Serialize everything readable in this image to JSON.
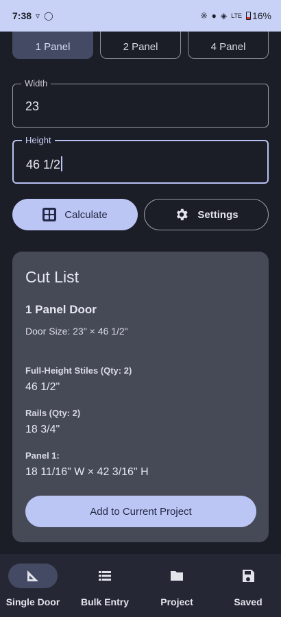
{
  "status_bar": {
    "time": "7:38",
    "signal_label": "LTE",
    "battery": "16%"
  },
  "panel_options": {
    "items": [
      "1 Panel",
      "2 Panel",
      "4 Panel"
    ],
    "selected": "1 Panel"
  },
  "inputs": {
    "width": {
      "label": "Width",
      "value": "23"
    },
    "height": {
      "label": "Height",
      "value": "46 1/2"
    }
  },
  "actions": {
    "calculate_label": "Calculate",
    "settings_label": "Settings"
  },
  "cut_list": {
    "title": "Cut List",
    "door_type": "1 Panel Door",
    "door_size": "Door Size: 23\" × 46 1/2\"",
    "stiles": {
      "label": "Full-Height Stiles (Qty: 2)",
      "value": "46 1/2\""
    },
    "rails": {
      "label": "Rails (Qty: 2)",
      "value": "18 3/4\""
    },
    "panel": {
      "label": "Panel 1:",
      "value": "18 11/16\" W × 42 3/16\" H"
    },
    "add_button_label": "Add to Current Project"
  },
  "nav": {
    "items": [
      {
        "label": "Single Door",
        "icon": "ruler-triangle-icon",
        "active": true
      },
      {
        "label": "Bulk Entry",
        "icon": "list-icon",
        "active": false
      },
      {
        "label": "Project",
        "icon": "folder-icon",
        "active": false
      },
      {
        "label": "Saved",
        "icon": "save-icon",
        "active": false
      }
    ]
  },
  "colors": {
    "background": "#1b1d27",
    "accent": "#bcc6f5",
    "card": "#464a57",
    "nav_bar": "#252734",
    "status_bar": "#c8d2f6"
  }
}
